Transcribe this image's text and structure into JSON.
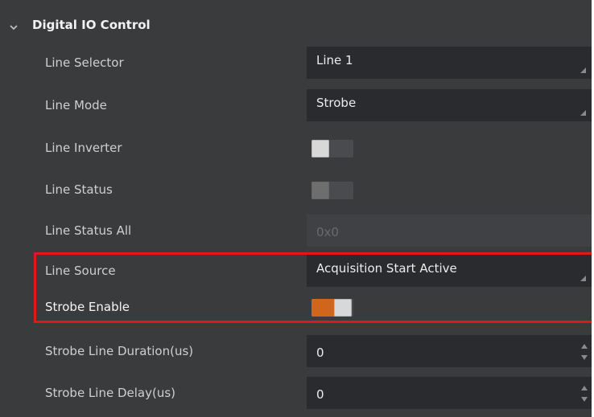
{
  "section": {
    "title": "Digital IO Control",
    "expanded": true
  },
  "rows": [
    {
      "label": "Line Selector",
      "type": "dropdown",
      "value": "Line 1"
    },
    {
      "label": "Line Mode",
      "type": "dropdown",
      "value": "Strobe"
    },
    {
      "label": "Line Inverter",
      "type": "toggle",
      "checked": false
    },
    {
      "label": "Line Status",
      "type": "toggle",
      "checked": false,
      "disabled": true
    },
    {
      "label": "Line Status All",
      "type": "readonly",
      "value": "0x0"
    },
    {
      "label": "Line Source",
      "type": "dropdown",
      "value": "Acquisition Start Active",
      "highlighted": true
    },
    {
      "label": "Strobe Enable",
      "type": "toggle",
      "checked": true,
      "highlighted": true
    },
    {
      "label": "Strobe Line Duration(us)",
      "type": "spinbox",
      "value": "0"
    },
    {
      "label": "Strobe Line Delay(us)",
      "type": "spinbox",
      "value": "0"
    }
  ],
  "colors": {
    "panel_bg": "#3a3b3d",
    "field_bg": "#2a2b2e",
    "toggle_on": "#d0661c",
    "highlight_border": "#e0171d"
  },
  "icons": {
    "section_toggle": "chevron-down-icon",
    "dropdown_corner": "dropdown-corner-icon",
    "spin": "spin-arrows-icon"
  }
}
